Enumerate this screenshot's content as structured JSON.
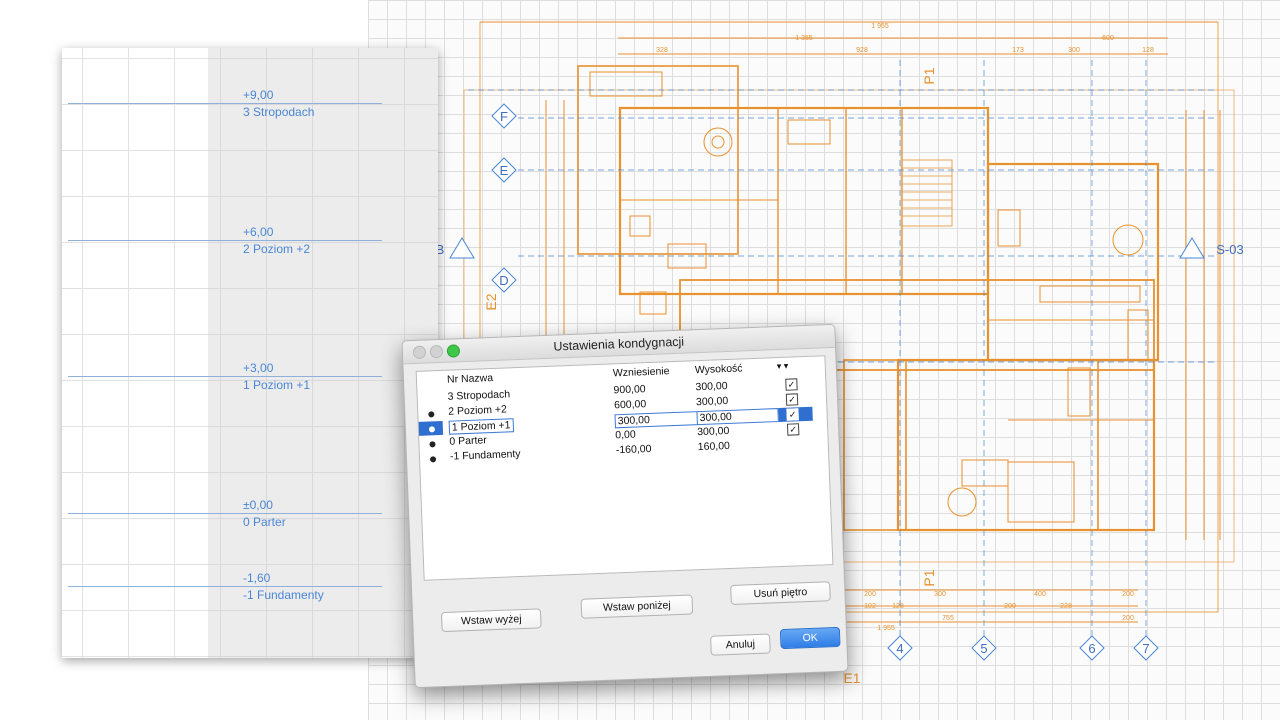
{
  "section_levels": [
    {
      "elevation": "+9,00",
      "name": "3 Stropodach"
    },
    {
      "elevation": "+6,00",
      "name": "2 Poziom +2"
    },
    {
      "elevation": "+3,00",
      "name": "1 Poziom +1"
    },
    {
      "elevation": "±0,00",
      "name": "0 Parter"
    },
    {
      "elevation": "-1,60",
      "name": "-1 Fundamenty"
    }
  ],
  "plan": {
    "axis_labels": [
      "F",
      "E",
      "D",
      "4",
      "5",
      "6",
      "7"
    ],
    "section_markers": [
      "P1",
      "P1",
      "E1",
      "S-03",
      "E2",
      "B"
    ],
    "dimensions_top": [
      "1 955",
      "1 355",
      "600",
      "328",
      "928",
      "173",
      "300",
      "128"
    ],
    "dimensions_bottom": [
      "200",
      "300",
      "400",
      "200",
      "102",
      "128",
      "200",
      "228",
      "755",
      "200",
      "1 955"
    ]
  },
  "dialog": {
    "title": "Ustawienia kondygnacji",
    "columns": {
      "nr_name": "Nr Nazwa",
      "elevation": "Wzniesienie",
      "height": "Wysokość"
    },
    "rows": [
      {
        "nr_name": "3 Stropodach",
        "elevation": "900,00",
        "height": "300,00",
        "checked": true,
        "selected": false
      },
      {
        "nr_name": "2 Poziom +2",
        "elevation": "600,00",
        "height": "300,00",
        "checked": true,
        "selected": false
      },
      {
        "nr_name": "1 Poziom +1",
        "elevation": "300,00",
        "height": "300,00",
        "checked": true,
        "selected": true
      },
      {
        "nr_name": "0 Parter",
        "elevation": "0,00",
        "height": "300,00",
        "checked": true,
        "selected": false
      },
      {
        "nr_name": "-1 Fundamenty",
        "elevation": "-160,00",
        "height": "160,00",
        "checked": false,
        "selected": false
      }
    ],
    "buttons": {
      "insert_above": "Wstaw wyżej",
      "insert_below": "Wstaw poniżej",
      "delete_floor": "Usuń piętro",
      "cancel": "Anuluj",
      "ok": "OK"
    }
  },
  "colors": {
    "plan_orange": "#e8922e",
    "plan_blue": "#4a86d6",
    "level_text": "#4a86d6",
    "selection": "#2f6fd0"
  }
}
